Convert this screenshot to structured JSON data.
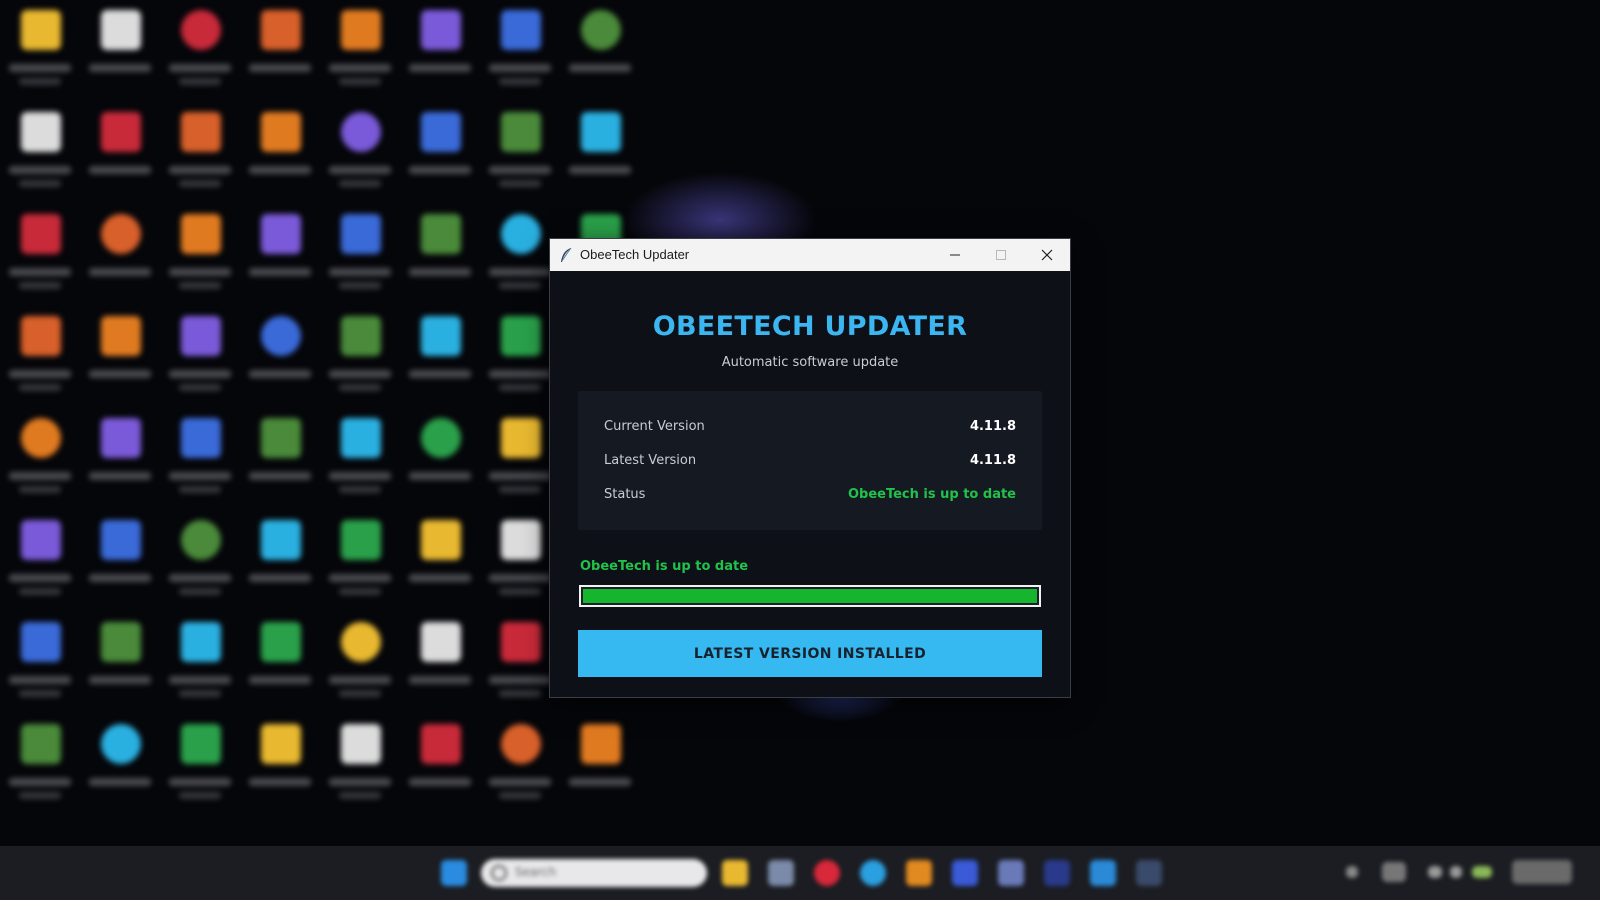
{
  "window": {
    "title": "ObeeTech Updater",
    "icon": "feather-icon"
  },
  "app": {
    "title": "OBEETECH UPDATER",
    "subtitle": "Automatic software update"
  },
  "info": {
    "rows": [
      {
        "label": "Current Version",
        "value": "4.11.8",
        "color": "#ffffff"
      },
      {
        "label": "Latest Version",
        "value": "4.11.8",
        "color": "#ffffff"
      },
      {
        "label": "Status",
        "value": "ObeeTech is up to date",
        "color": "#22c24a"
      }
    ]
  },
  "status_message": "ObeeTech is up to date",
  "progress": {
    "fraction": 1.0
  },
  "action_button": {
    "label": "LATEST VERSION INSTALLED"
  },
  "colors": {
    "accent": "#36b8f1",
    "success": "#22c24a",
    "progress_fill": "#16b52e",
    "window_bg": "#0d1017"
  },
  "taskbar": {
    "search_placeholder": "Search"
  }
}
